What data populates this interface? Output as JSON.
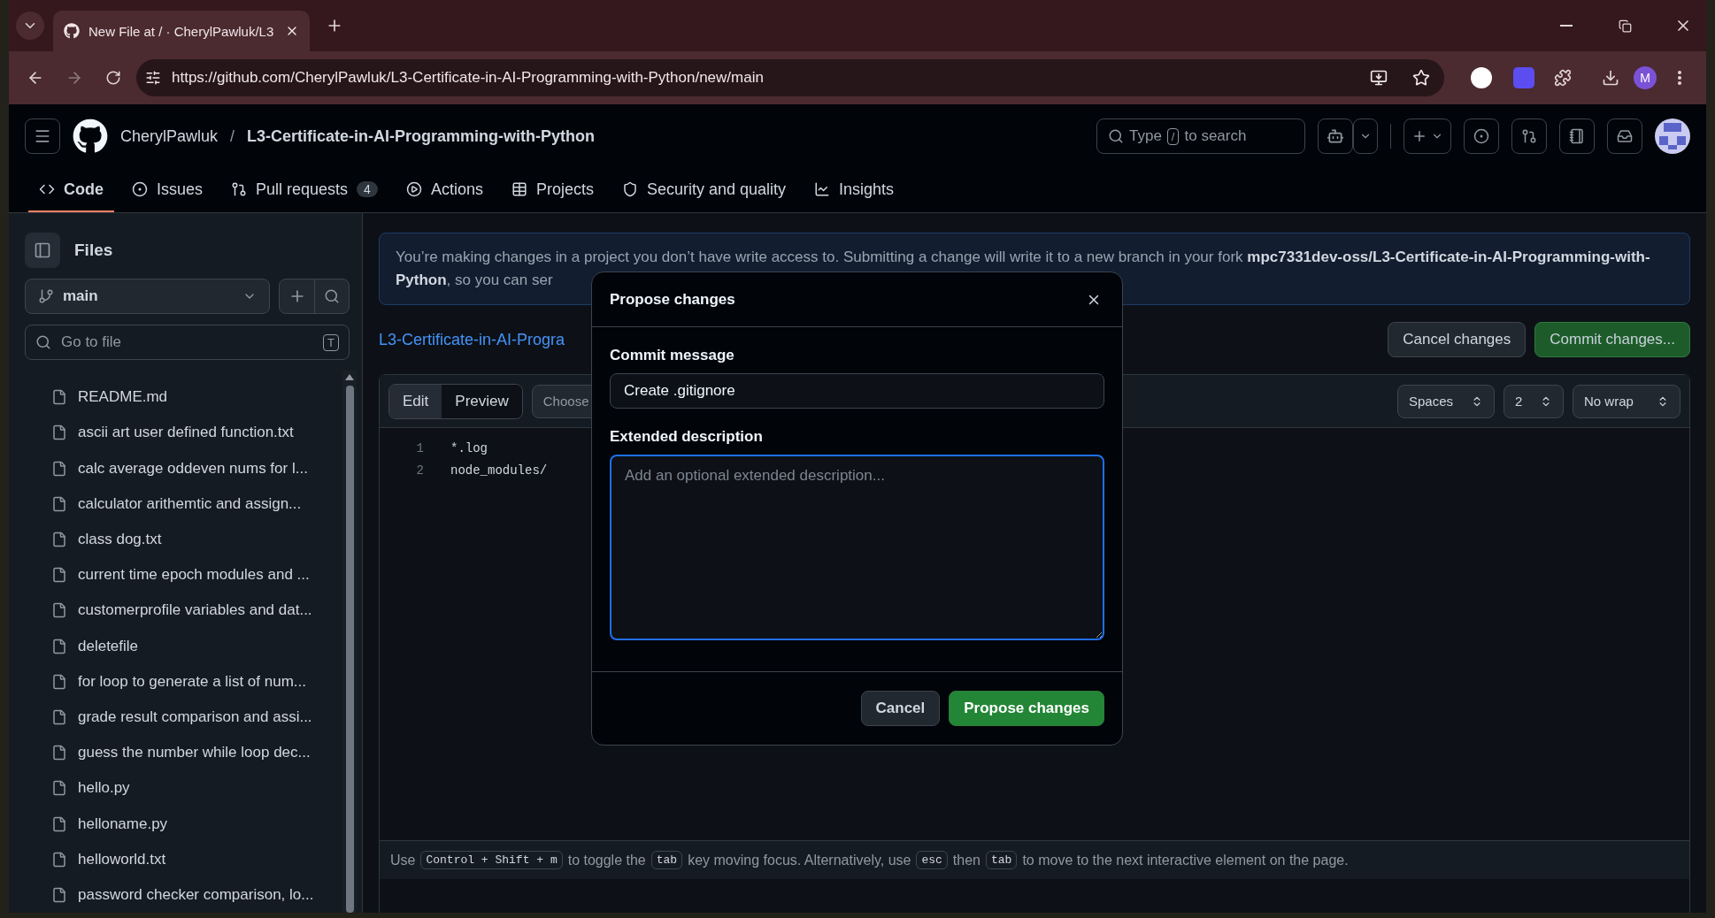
{
  "browser": {
    "tabs": [
      {
        "title": "New File at / · CherylPawluk/L3",
        "selected": true
      }
    ],
    "url": "https://github.com/CherylPawluk/L3-Certificate-in-AI-Programming-with-Python/new/main",
    "profile": "M"
  },
  "header": {
    "owner": "CherylPawluk",
    "separator": "/",
    "repo": "L3-Certificate-in-AI-Programming-with-Python",
    "search": {
      "before": "Type",
      "key": "/",
      "after": "to search"
    }
  },
  "nav": [
    {
      "label": "Code",
      "selected": true
    },
    {
      "label": "Issues",
      "selected": false
    },
    {
      "label": "Pull requests",
      "selected": false,
      "counter": "4"
    },
    {
      "label": "Actions",
      "selected": false
    },
    {
      "label": "Projects",
      "selected": false
    },
    {
      "label": "Security and quality",
      "selected": false
    },
    {
      "label": "Insights",
      "selected": false
    }
  ],
  "sidebar": {
    "title": "Files",
    "branch": "main",
    "filter": {
      "placeholder": "Go to file",
      "shortcut": "T"
    },
    "files": [
      "README.md",
      "ascii art user defined function.txt",
      "calc average oddeven nums for l...",
      "calculator arithemtic and assign...",
      "class dog.txt",
      "current time epoch modules and ...",
      "customerprofile variables and dat...",
      "deletefile",
      "for loop to generate a list of num...",
      "grade result comparison and assi...",
      "guess the number while loop dec...",
      "hello.py",
      "helloname.py",
      "helloworld.txt",
      "password checker comparison, lo..."
    ]
  },
  "banner": {
    "text": "You’re making changes in a project you don’t have write access to. Submitting a change will write it to a new branch in your fork **mpc7331dev-oss/L3-Certificate-in-AI-Programming-with-Python**, so you can ser"
  },
  "editor": {
    "path": "L3-Certificate-in-AI-Progra",
    "cancel": "Cancel changes",
    "commit": "Commit changes...",
    "tabs": [
      {
        "label": "Edit",
        "selected": true
      },
      {
        "label": "Preview",
        "selected": false
      }
    ],
    "template": "Choose",
    "indent_mode": "Spaces",
    "indent_size": "2",
    "wrap_mode": "No wrap",
    "lines": [
      {
        "number": "1",
        "text": "*.log"
      },
      {
        "number": "2",
        "text": "node_modules/"
      }
    ],
    "hint": [
      {
        "kind": "text",
        "text": "Use"
      },
      {
        "kind": "key",
        "text": "Control + Shift + m"
      },
      {
        "kind": "text",
        "text": "to toggle the"
      },
      {
        "kind": "key",
        "text": "tab"
      },
      {
        "kind": "text",
        "text": "key moving focus. Alternatively, use"
      },
      {
        "kind": "key",
        "text": "esc"
      },
      {
        "kind": "text",
        "text": "then"
      },
      {
        "kind": "key",
        "text": "tab"
      },
      {
        "kind": "text",
        "text": "to move to the next interactive element on the page."
      }
    ]
  },
  "dialog": {
    "title": "Propose changes",
    "message_label": "Commit message",
    "message_value": "Create .gitignore",
    "description_label": "Extended description",
    "description_placeholder": "Add an optional extended description...",
    "cancel": "Cancel",
    "submit": "Propose changes"
  }
}
